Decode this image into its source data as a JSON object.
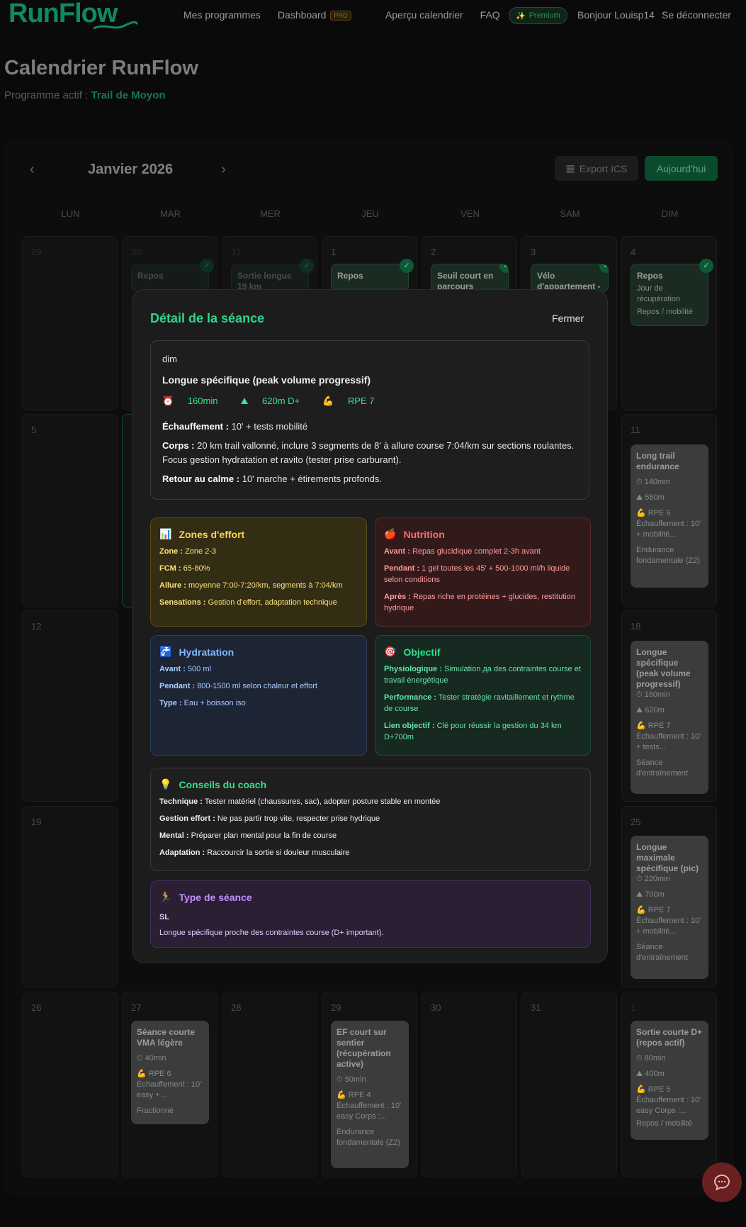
{
  "nav": {
    "brand": "RunFlow",
    "links": [
      "Mes programmes",
      "Dashboard",
      "Aperçu calendrier",
      "FAQ"
    ],
    "pro_badge": "PRO",
    "premium": "Premium",
    "greeting": "Bonjour Louisp14",
    "logout": "Se déconnecter"
  },
  "page": {
    "title": "Calendrier RunFlow",
    "program_label": "Programme actif :",
    "program_name": "Trail de Moyon"
  },
  "calendar": {
    "month": "Janvier 2026",
    "export": "Export ICS",
    "today": "Aujourd'hui",
    "weekdays": [
      "LUN",
      "MAR",
      "MER",
      "JEU",
      "VEN",
      "SAM",
      "DIM"
    ],
    "days": {
      "w1": [
        "29",
        "30",
        "31",
        "1",
        "2",
        "3",
        "4"
      ],
      "w2": [
        "5",
        "",
        "",
        "",
        "",
        "",
        "11"
      ],
      "w3": [
        "12",
        "",
        "",
        "",
        "",
        "",
        "18"
      ],
      "w4": [
        "19",
        "",
        "",
        "",
        "",
        "",
        "25"
      ],
      "w5": [
        "26",
        "27",
        "28",
        "29",
        "30",
        "31",
        "1"
      ]
    },
    "events": {
      "w1_tue": "Repos",
      "w1_wed": "Sortie longue 19 km",
      "w1_thu": "Repos",
      "w1_fri": "Seuil court en parcours",
      "w1_sat": "Vélo d'appartement -",
      "w1_sun": {
        "title": "Repos",
        "desc": "Jour de récupération",
        "tag": "Repos / mobilité"
      },
      "w2_sun": {
        "title": "Long trail endurance",
        "dur": "140min",
        "dplus": "580m",
        "rpe": "RPE 6",
        "warm": "Échauffement : 10' + mobilité...",
        "tag": "Endurance fondamentale (Z2)"
      },
      "w3_sun": {
        "title": "Longue spécifique (peak volume progressif)",
        "dur": "160min",
        "dplus": "620m",
        "rpe": "RPE 7",
        "warm": "Échauffement : 10' + tests...",
        "tag": "Séance d'entraînement"
      },
      "w4_sun": {
        "title": "Longue maximale spécifique (pic)",
        "dur": "220min",
        "dplus": "700m",
        "rpe": "RPE 7",
        "warm": "Échauffement : 10' + mobilité...",
        "tag": "Séance d'entraînement"
      },
      "w5_tue": {
        "title": "Séance courte VMA légère",
        "dur": "40min",
        "rpe": "RPE 6",
        "warm": "Échauffement : 10' easy +...",
        "tag": "Fractionné"
      },
      "w5_thu": {
        "title": "EF court sur sentier (récupération active)",
        "dur": "50min",
        "rpe": "RPE 4",
        "warm": "Échauffement : 10' easy Corps :...",
        "tag": "Endurance fondamentale (Z2)"
      },
      "w5_sun": {
        "title": "Sortie courte D+ (repos actif)",
        "dur": "80min",
        "dplus": "400m",
        "rpe": "RPE 5",
        "warm": "Échauffement : 10' easy Corps :...",
        "tag": "Repos / mobilité"
      }
    }
  },
  "modal": {
    "title": "Détail de la séance",
    "close": "Fermer",
    "day": "dim",
    "session": "Longue spécifique (peak volume progressif)",
    "duration": "160min",
    "dplus": "620m D+",
    "rpe": "RPE 7",
    "warmup_label": "Échauffement :",
    "warmup": "10' + tests mobilité",
    "body_label": "Corps :",
    "body": "20 km trail vallonné, inclure 3 segments de 8' à allure course 7:04/km sur sections roulantes. Focus gestion hydratation et ravito (tester prise carburant).",
    "cooldown_label": "Retour au calme :",
    "cooldown": "10' marche + étirements profonds.",
    "zones": {
      "title": "Zones d'effort",
      "items": [
        {
          "k": "Zone :",
          "v": "Zone 2-3"
        },
        {
          "k": "FCM :",
          "v": "65-80%"
        },
        {
          "k": "Allure :",
          "v": "moyenne 7:00-7:20/km, segments à 7:04/km"
        },
        {
          "k": "Sensations :",
          "v": "Gestion d'effort, adaptation technique"
        }
      ]
    },
    "nutrition": {
      "title": "Nutrition",
      "items": [
        {
          "k": "Avant :",
          "v": "Repas glucidique complet 2-3h avant"
        },
        {
          "k": "Pendant :",
          "v": "1 gel toutes les 45' + 500-1000 ml/h liquide selon conditions"
        },
        {
          "k": "Après :",
          "v": "Repas riche en protéines + glucides, restitution hydrique"
        }
      ]
    },
    "hydration": {
      "title": "Hydratation",
      "items": [
        {
          "k": "Avant :",
          "v": "500 ml"
        },
        {
          "k": "Pendant :",
          "v": "800-1500 ml selon chaleur et effort"
        },
        {
          "k": "Type :",
          "v": "Eau + boisson iso"
        }
      ]
    },
    "objective": {
      "title": "Objectif",
      "items": [
        {
          "k": "Physiologique :",
          "v": "Simulation да des contraintes course et travail énergétique"
        },
        {
          "k": "Performance :",
          "v": "Tester stratégie ravitaillement et rythme de course"
        },
        {
          "k": "Lien objectif :",
          "v": "Clé pour réussir la gestion du 34 km D+700m"
        }
      ]
    },
    "coach": {
      "title": "Conseils du coach",
      "items": [
        {
          "k": "Technique :",
          "v": "Tester matériel (chaussures, sac), adopter posture stable en montée"
        },
        {
          "k": "Gestion effort :",
          "v": "Ne pas partir trop vite, respecter prise hydrique"
        },
        {
          "k": "Mental :",
          "v": "Préparer plan mental pour la fin de course"
        },
        {
          "k": "Adaptation :",
          "v": "Raccourcir la sortie si douleur musculaire"
        }
      ]
    },
    "type": {
      "title": "Type de séance",
      "code": "SL",
      "desc": "Longue spécifique proche des contraintes course (D+ important)."
    }
  },
  "colors": {
    "accent": "#2fd58a",
    "brand": "#0f8a5f"
  }
}
